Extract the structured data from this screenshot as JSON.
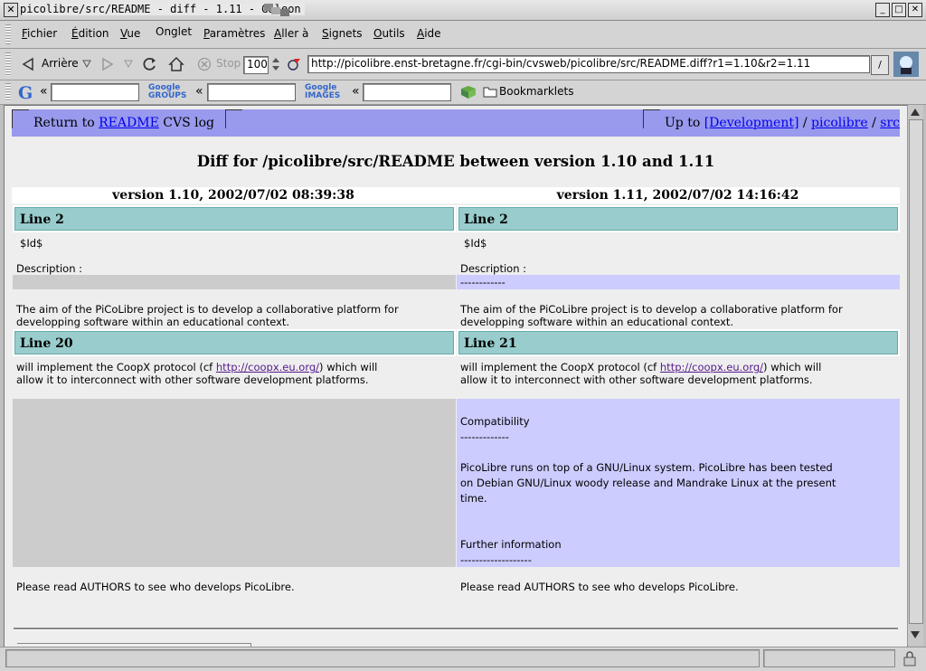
{
  "window": {
    "title": "picolibre/src/README - diff - 1.11 - Galeon",
    "close_glyph": "✕",
    "min_glyph": "_",
    "max_glyph": "□"
  },
  "menu": {
    "items": [
      {
        "pre": "",
        "u": "F",
        "post": "ichier"
      },
      {
        "pre": "",
        "u": "É",
        "post": "dition"
      },
      {
        "pre": "",
        "u": "V",
        "post": "ue"
      },
      {
        "pre": "Onglet",
        "u": "",
        "post": ""
      },
      {
        "pre": "",
        "u": "P",
        "post": "aramètres"
      },
      {
        "pre": "",
        "u": "A",
        "post": "ller à"
      },
      {
        "pre": "",
        "u": "S",
        "post": "ignets"
      },
      {
        "pre": "",
        "u": "O",
        "post": "utils"
      },
      {
        "pre": "",
        "u": "A",
        "post": "ide"
      }
    ]
  },
  "toolbar": {
    "back_label": "Arrière",
    "stop_label": "Stop",
    "zoom_value": "100",
    "url": "http://picolibre.enst-bretagne.fr/cgi-bin/cvsweb/picolibre/src/README.diff?r1=1.10&r2=1.11"
  },
  "searchbar": {
    "google_label": "Google",
    "groups_label": "Google GROUPS",
    "images_label": "Google IMAGES",
    "bookmarklets_label": "Bookmarklets",
    "arrow": "«"
  },
  "page": {
    "nav": {
      "return_prefix": "Return to ",
      "return_link": "README",
      "return_suffix": " CVS log",
      "upto_prefix": "Up to ",
      "dev_link": "[Development]",
      "sep1": " / ",
      "picolibre_link": "picolibre",
      "sep2": " / ",
      "src_link": "src"
    },
    "heading": "Diff for /picolibre/src/README between version 1.10 and 1.11",
    "left_version": "version 1.10, 2002/07/02 08:39:38",
    "right_version": "version 1.11, 2002/07/02 14:16:42",
    "hunk1": {
      "left_line": "Line 2",
      "right_line": "Line 2"
    },
    "hunk2": {
      "left_line": "Line 20",
      "right_line": "Line 21"
    },
    "id_text": "$Id$",
    "description": "Description :",
    "dashes_short": "------------",
    "aim_1": "The aim of the PiCoLibre project is to develop a collaborative platform for",
    "aim_2": "developping software within an educational context.",
    "coop_1_pre": "will implement the CoopX protocol (cf ",
    "coop_link": "http://coopx.eu.org/",
    "coop_1_post": ") which will",
    "coop_2": "allow it to interconnect with other software development platforms.",
    "compat": "Compatibility",
    "compat_dashes": "-------------",
    "runs_1": "PicoLibre runs on top of a GNU/Linux system. PicoLibre has been tested",
    "runs_2": "on Debian GNU/Linux woody release and Mandrake Linux at the present",
    "runs_3": "time.",
    "further": "Further information",
    "further_dashes": "-------------------",
    "authors": "Please read AUTHORS to see who develops PicoLibre."
  }
}
